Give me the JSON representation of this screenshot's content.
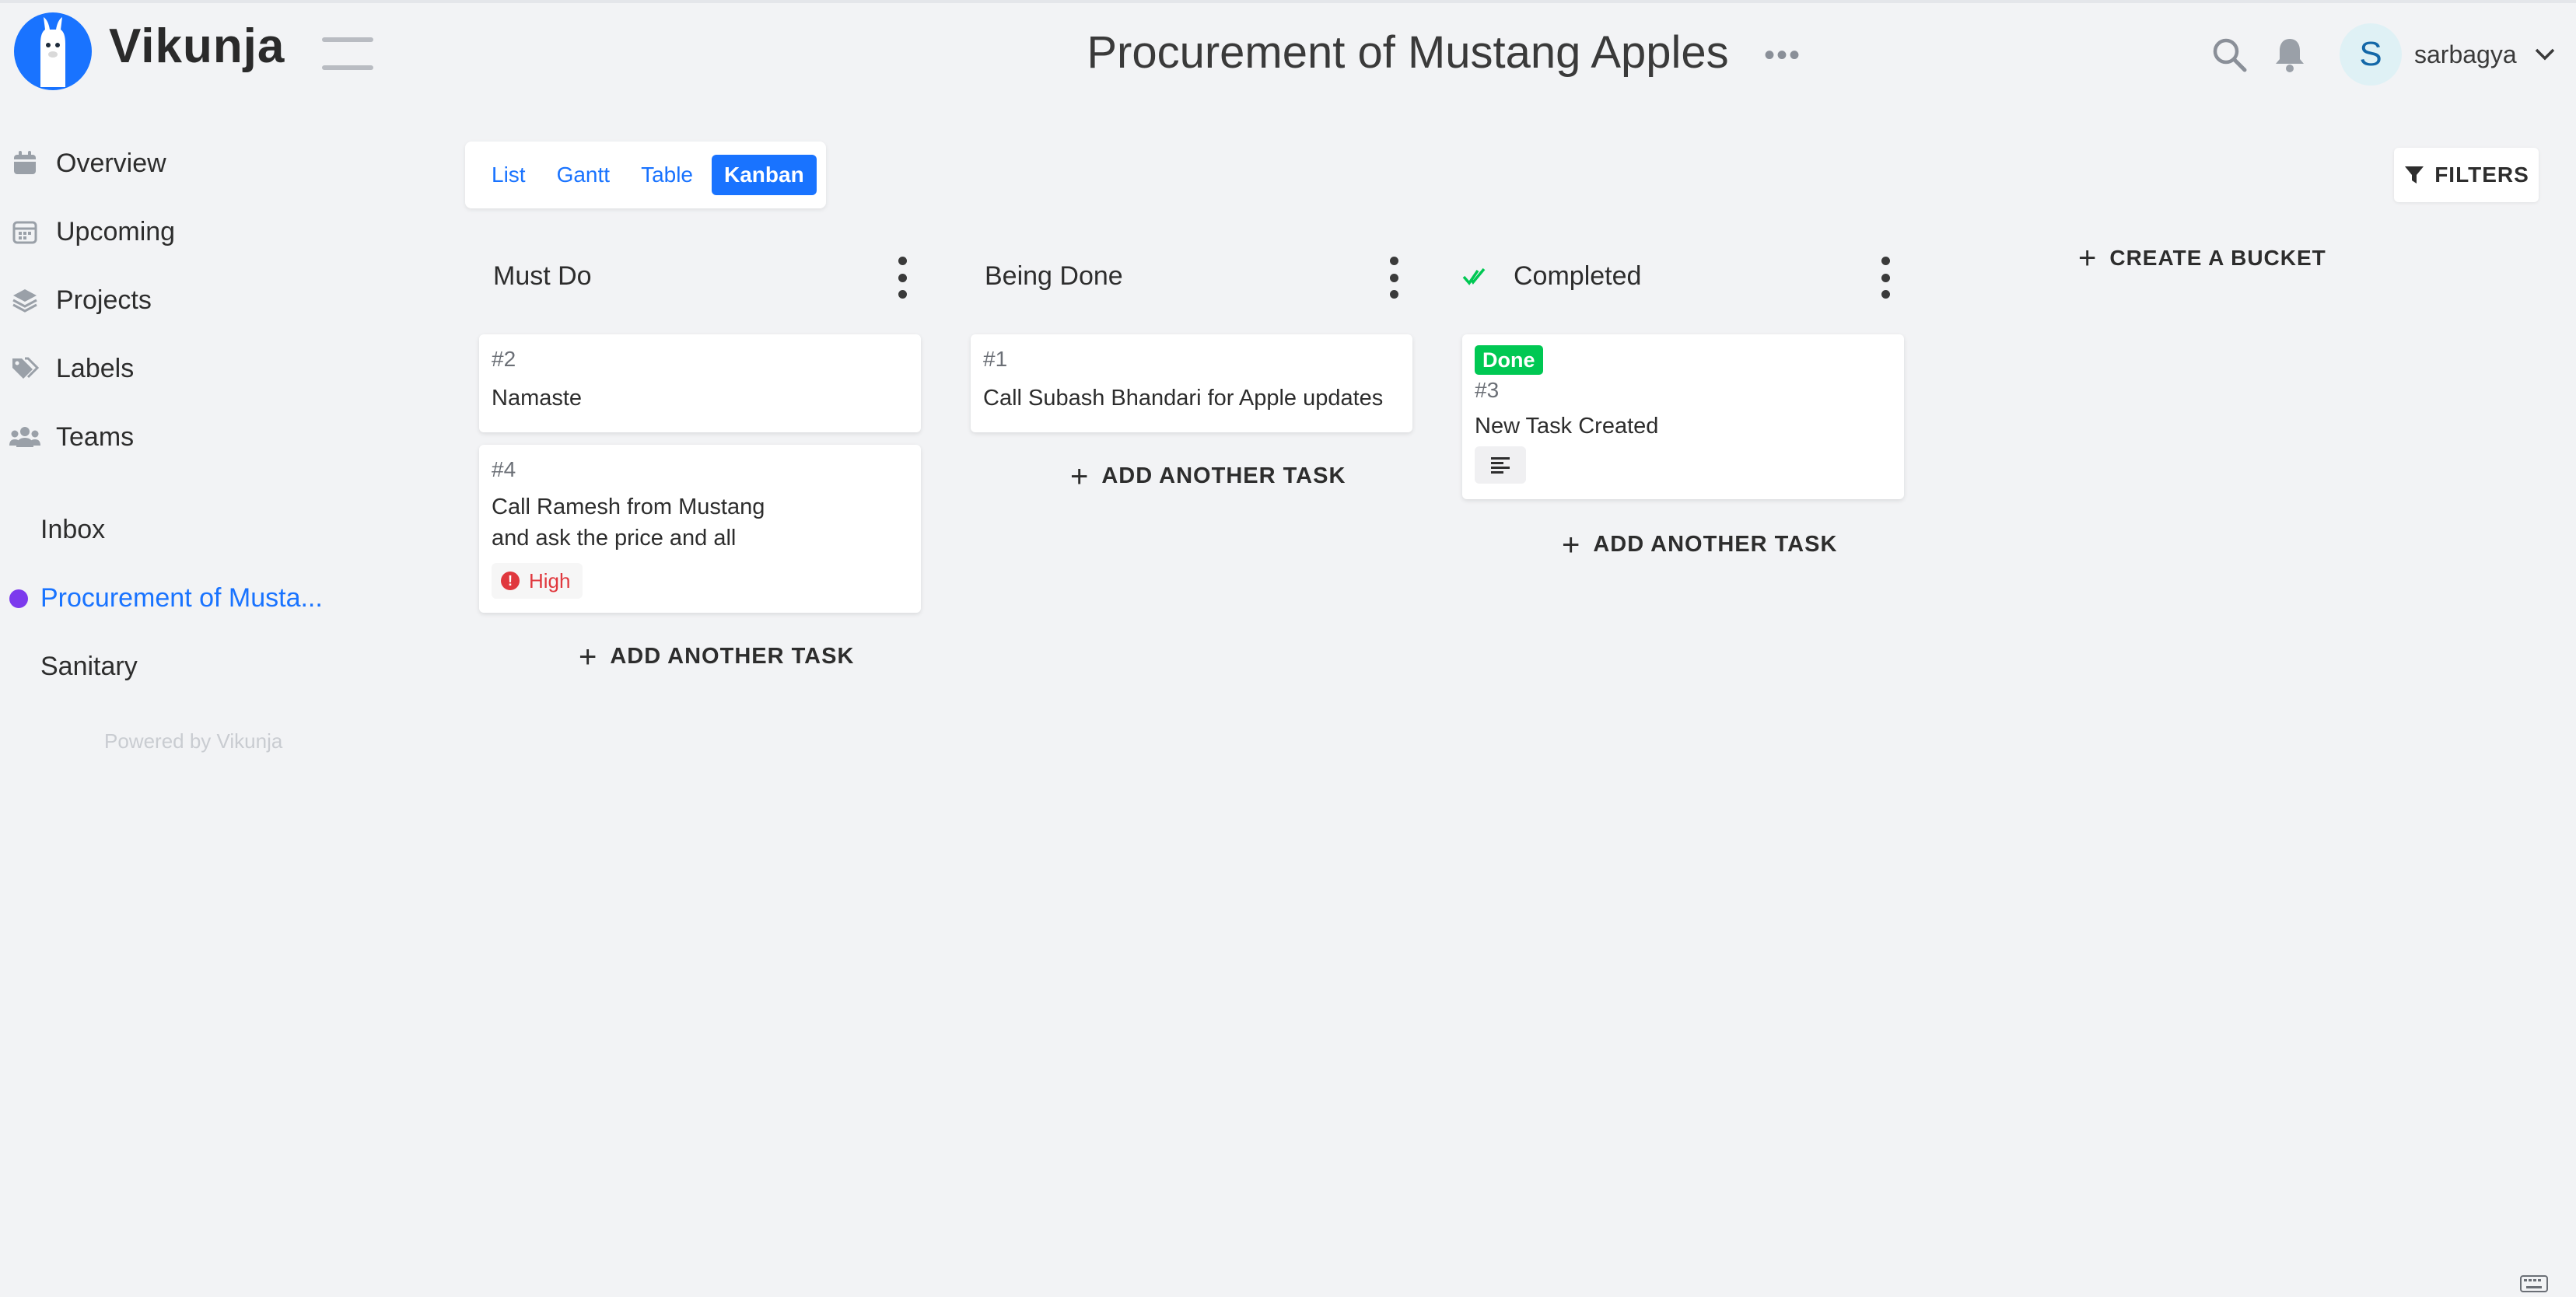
{
  "app": {
    "name": "Vikunja"
  },
  "header": {
    "page_title": "Procurement of Mustang Apples",
    "title_menu": "•••",
    "avatar_letter": "S",
    "username": "sarbagya"
  },
  "sidebar": {
    "nav": [
      {
        "label": "Overview",
        "icon": "calendar-icon"
      },
      {
        "label": "Upcoming",
        "icon": "calendar-grid-icon"
      },
      {
        "label": "Projects",
        "icon": "layers-icon"
      },
      {
        "label": "Labels",
        "icon": "tags-icon"
      },
      {
        "label": "Teams",
        "icon": "users-icon"
      }
    ],
    "projects": [
      {
        "label": "Inbox"
      },
      {
        "label": "Procurement of Musta...",
        "active": true,
        "color": "#7c3aed"
      },
      {
        "label": "Sanitary"
      }
    ],
    "powered_by": "Powered by Vikunja"
  },
  "views": {
    "items": [
      "List",
      "Gantt",
      "Table",
      "Kanban"
    ],
    "active": "Kanban",
    "filters_label": "FILTERS"
  },
  "kanban": {
    "buckets": [
      {
        "title": "Must Do",
        "tasks": [
          {
            "id": "#2",
            "title": "Namaste"
          },
          {
            "id": "#4",
            "title_lines": [
              "Call Ramesh from Mustang",
              "and ask the price and all"
            ],
            "priority": "High"
          }
        ],
        "add_label": "ADD ANOTHER TASK"
      },
      {
        "title": "Being Done",
        "tasks": [
          {
            "id": "#1",
            "title": "Call Subash Bhandari for Apple updates"
          }
        ],
        "add_label": "ADD ANOTHER TASK"
      },
      {
        "title": "Completed",
        "done_bucket": true,
        "tasks": [
          {
            "id": "#3",
            "title": "New Task Created",
            "badge": "Done",
            "has_description": true
          }
        ],
        "add_label": "ADD ANOTHER TASK"
      }
    ],
    "create_bucket_label": "CREATE A BUCKET"
  },
  "colors": {
    "accent": "#1973ff",
    "done": "#00c853",
    "priority_high": "#e0383e",
    "background": "#f2f3f5"
  }
}
